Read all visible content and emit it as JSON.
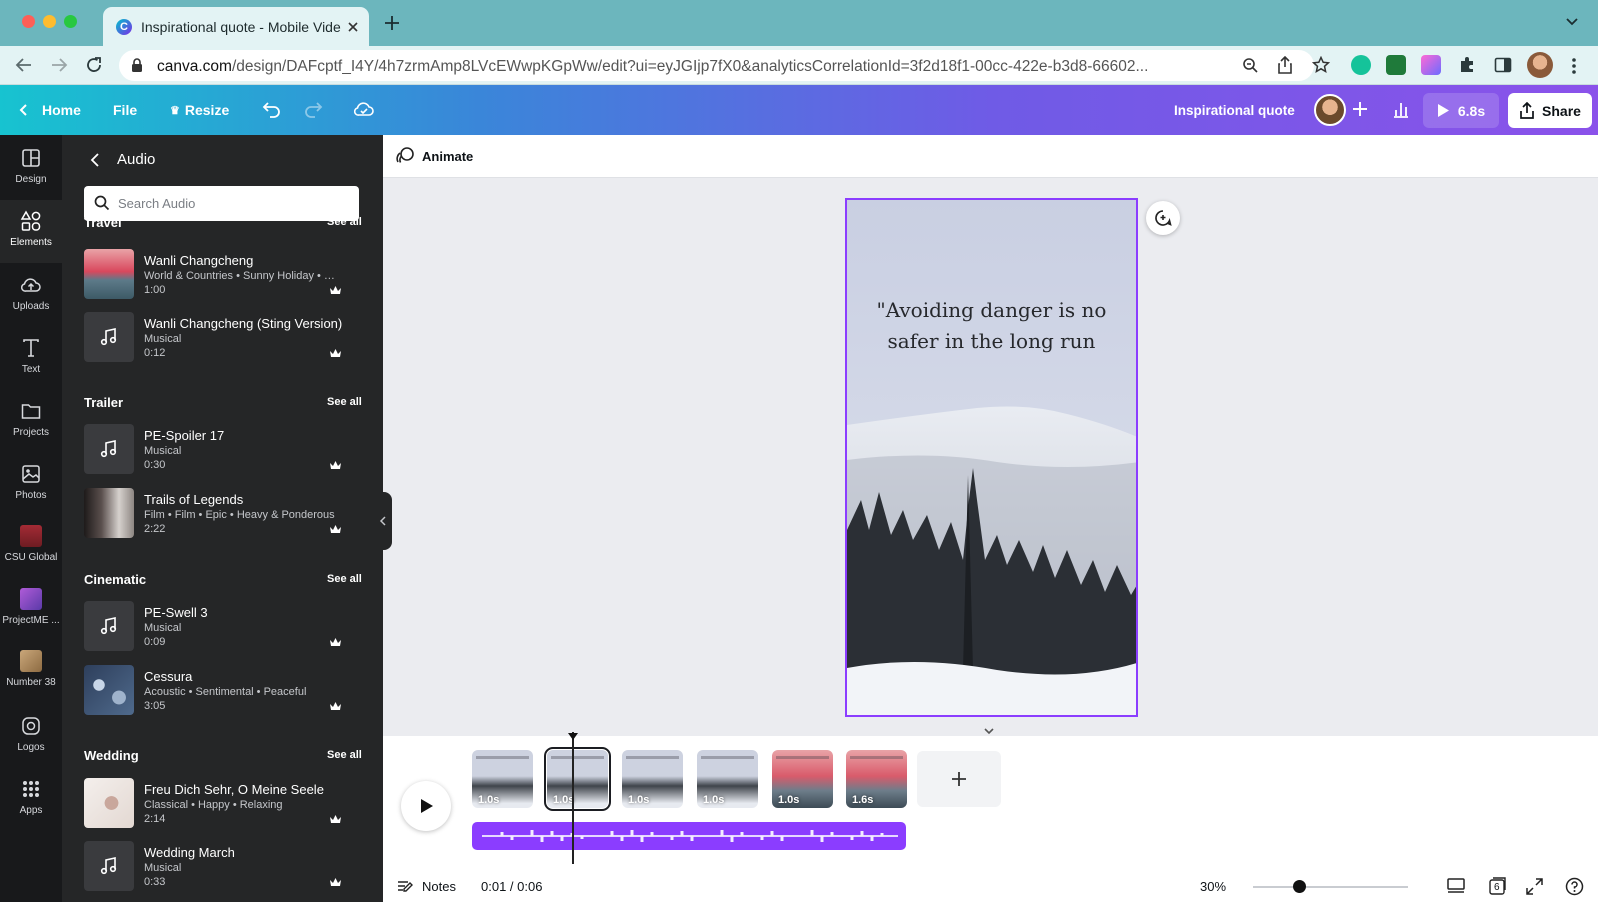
{
  "browser": {
    "tab_title": "Inspirational quote - Mobile Video",
    "url_domain": "canva.com",
    "url_path": "/design/DAFcptf_I4Y/4h7zrmAmp8LVcEWwpKGpWw/edit?ui=eyJGIjp7fX0&analyticsCorrelationId=3f2d18f1-00cc-422e-b3d8-66602..."
  },
  "topbar": {
    "home": "Home",
    "file": "File",
    "resize": "Resize",
    "design_title": "Inspirational quote",
    "present_duration": "6.8s",
    "share": "Share"
  },
  "rail": {
    "items": [
      {
        "label": "Design",
        "icon": "layout-icon"
      },
      {
        "label": "Elements",
        "icon": "shapes-icon"
      },
      {
        "label": "Uploads",
        "icon": "cloud-upload-icon"
      },
      {
        "label": "Text",
        "icon": "text-icon"
      },
      {
        "label": "Projects",
        "icon": "folder-icon"
      },
      {
        "label": "Photos",
        "icon": "image-icon"
      },
      {
        "label": "CSU Global",
        "icon": "brand-csu-icon"
      },
      {
        "label": "ProjectME ...",
        "icon": "brand-projectme-icon"
      },
      {
        "label": "Number 38",
        "icon": "brand-number38-icon"
      },
      {
        "label": "Logos",
        "icon": "logo-icon"
      },
      {
        "label": "Apps",
        "icon": "apps-grid-icon"
      }
    ]
  },
  "panel": {
    "title": "Audio",
    "search_placeholder": "Search Audio",
    "see_all": "See all",
    "sections": [
      {
        "name": "Travel",
        "tracks": [
          {
            "title": "Wanli Changcheng",
            "tags": "World & Countries • Sunny Holiday • Optimistic",
            "duration": "1:00"
          },
          {
            "title": "Wanli Changcheng (Sting Version)",
            "tags": "Musical",
            "duration": "0:12"
          }
        ]
      },
      {
        "name": "Trailer",
        "tracks": [
          {
            "title": "PE-Spoiler 17",
            "tags": "Musical",
            "duration": "0:30"
          },
          {
            "title": "Trails of Legends",
            "tags": "Film • Film • Epic • Heavy & Ponderous",
            "duration": "2:22"
          }
        ]
      },
      {
        "name": "Cinematic",
        "tracks": [
          {
            "title": "PE-Swell 3",
            "tags": "Musical",
            "duration": "0:09"
          },
          {
            "title": "Cessura",
            "tags": "Acoustic • Sentimental • Peaceful",
            "duration": "3:05"
          }
        ]
      },
      {
        "name": "Wedding",
        "tracks": [
          {
            "title": "Freu Dich Sehr, O Meine Seele",
            "tags": "Classical • Happy • Relaxing",
            "duration": "2:14"
          },
          {
            "title": "Wedding March",
            "tags": "Musical",
            "duration": "0:33"
          }
        ]
      }
    ]
  },
  "editor": {
    "animate": "Animate",
    "quote": "\"Avoiding danger is no safer in the long run"
  },
  "timeline": {
    "scenes": [
      "1.0s",
      "1.0s",
      "1.0s",
      "1.0s",
      "1.0s",
      "1.6s"
    ],
    "selected_scene": 2,
    "time": "0:01 / 0:06"
  },
  "bottombar": {
    "notes": "Notes",
    "zoom": "30%",
    "zoom_fraction": 0.3,
    "page_count": "6"
  },
  "colors": {
    "accent": "#8b3dff",
    "rail_bg": "#18191b",
    "panel_bg": "#252627",
    "browser_tab": "#6cb6bd"
  }
}
